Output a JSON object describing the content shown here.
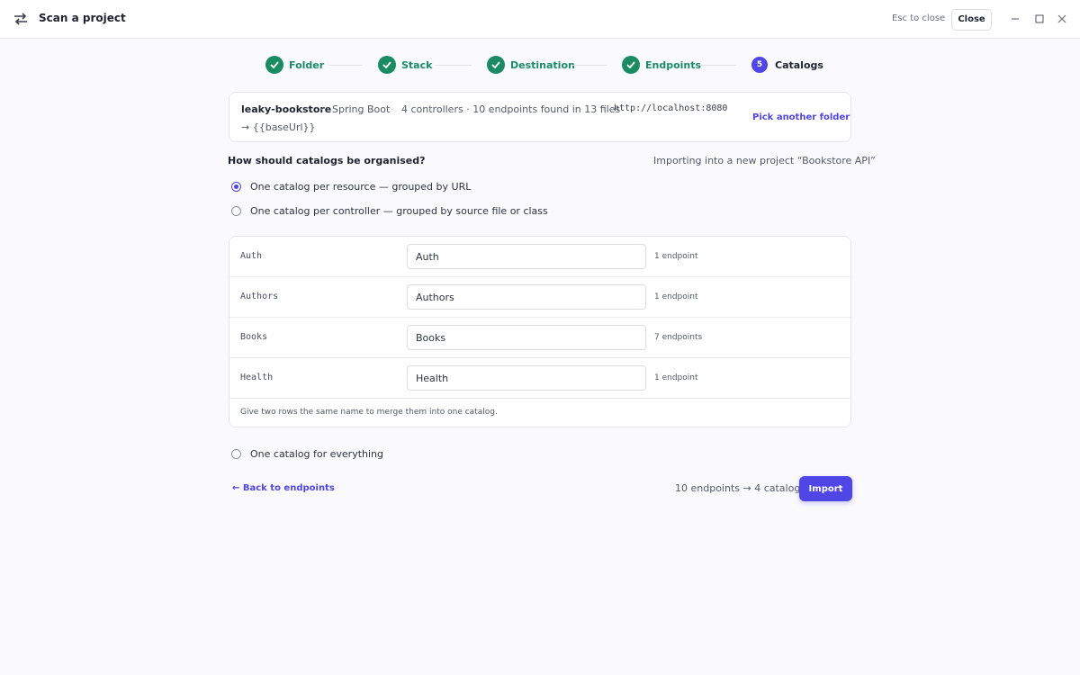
{
  "window": {
    "title": "Scan a project",
    "esc_hint": "Esc to close",
    "close_label": "Close"
  },
  "stepper": {
    "steps": [
      {
        "label": "Folder",
        "state": "done"
      },
      {
        "label": "Stack",
        "state": "done"
      },
      {
        "label": "Destination",
        "state": "done"
      },
      {
        "label": "Endpoints",
        "state": "done"
      },
      {
        "label": "Catalogs",
        "state": "active",
        "number": "5"
      }
    ]
  },
  "project": {
    "name": "leaky-bookstore",
    "stack": "Spring Boot",
    "found": "4 controllers · 10 endpoints found in 13 files",
    "url": "http://localhost:8080",
    "base": "→ {{baseUrl}}",
    "pick_label": "Pick another folder",
    "separator": "·"
  },
  "organise": {
    "question": "How should catalogs be organised?",
    "importing": "Importing into a new project “Bookstore API”",
    "options": [
      {
        "label": "One catalog per resource — grouped by URL",
        "selected": true
      },
      {
        "label": "One catalog per controller — grouped by source file or class",
        "selected": false
      },
      {
        "label": "One catalog for everything",
        "selected": false
      }
    ]
  },
  "catalogs": {
    "rows": [
      {
        "key": "Auth",
        "value": "Auth",
        "count": "1 endpoint"
      },
      {
        "key": "Authors",
        "value": "Authors",
        "count": "1 endpoint"
      },
      {
        "key": "Books",
        "value": "Books",
        "count": "7 endpoints"
      },
      {
        "key": "Health",
        "value": "Health",
        "count": "1 endpoint"
      }
    ],
    "hint": "Give two rows the same name to merge them into one catalog."
  },
  "footer": {
    "back_label": "← Back to endpoints",
    "summary": "10 endpoints → 4 catalogs",
    "import_label": "Import"
  },
  "colors": {
    "accent": "#4f46e5",
    "done": "#1b8b63"
  }
}
